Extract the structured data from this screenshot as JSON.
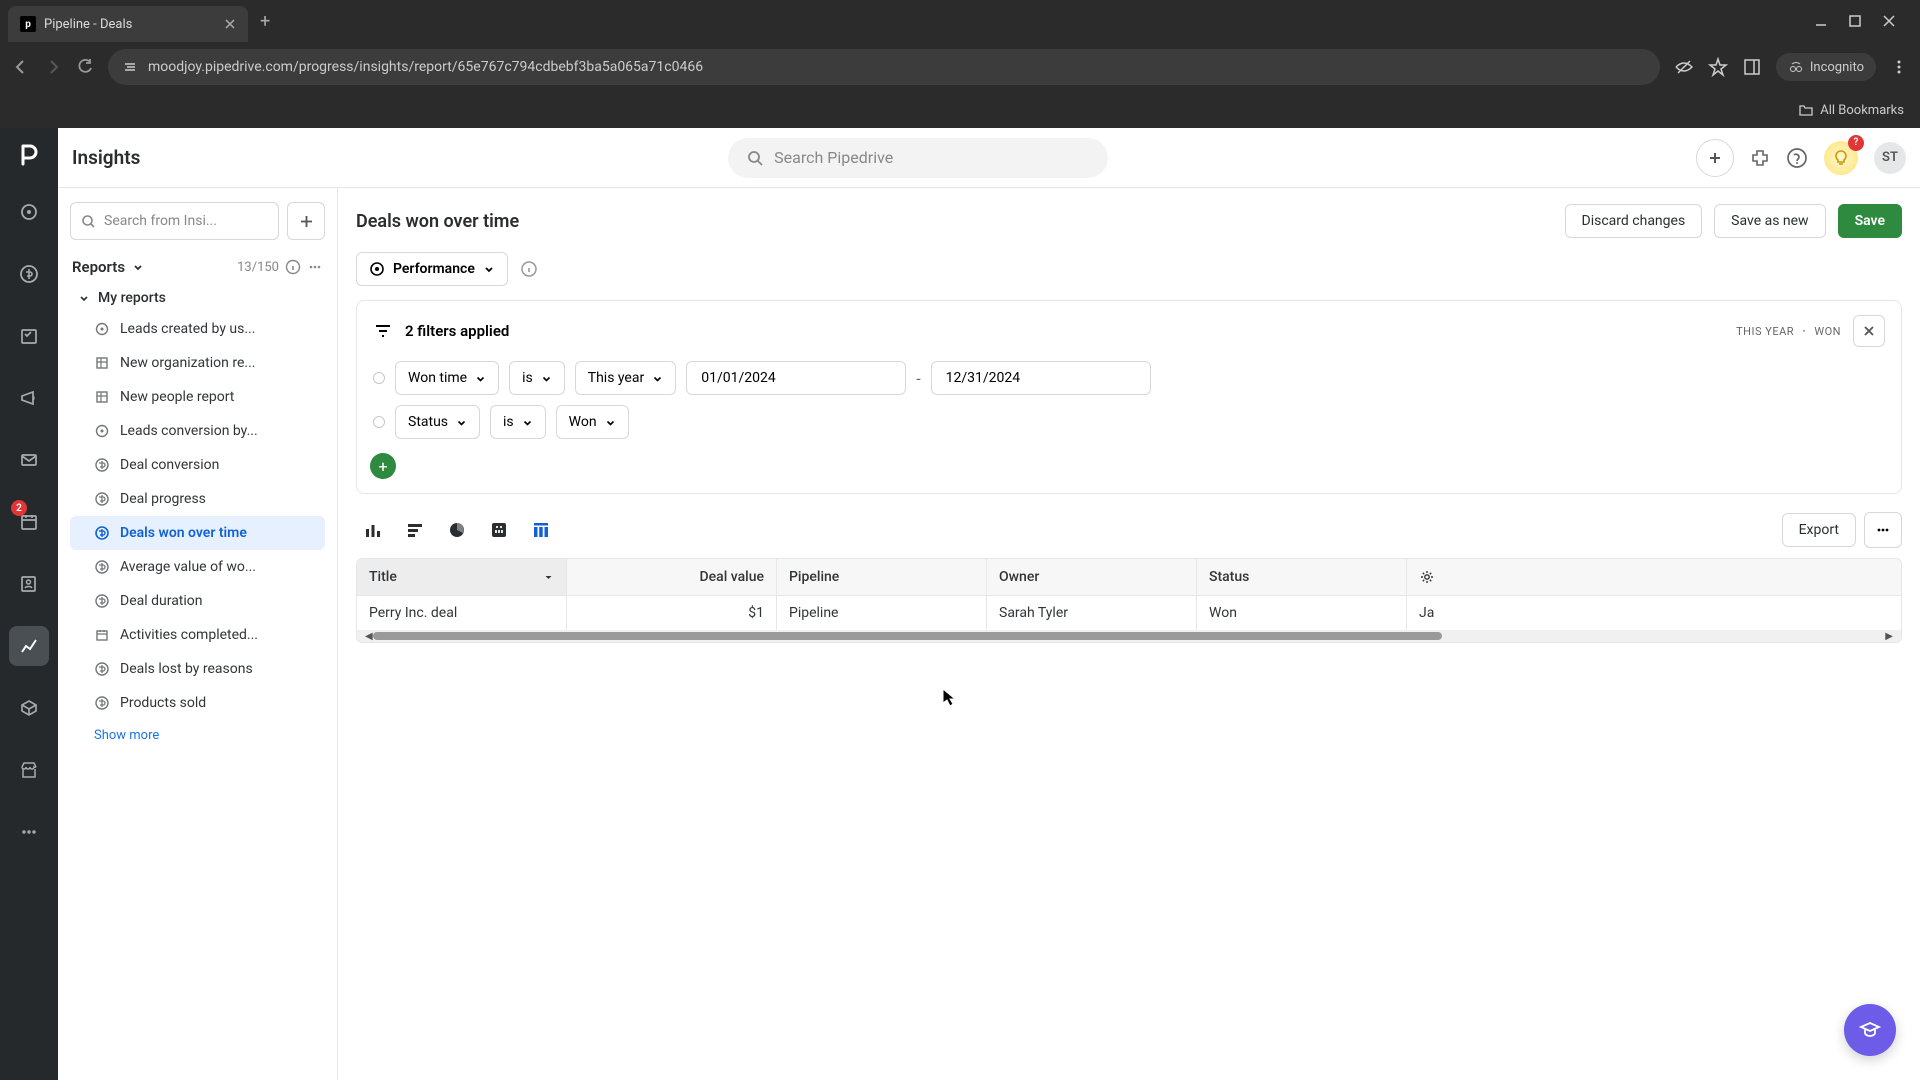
{
  "browser": {
    "tab_title": "Pipeline - Deals",
    "url": "moodjoy.pipedrive.com/progress/insights/report/65e767c794cdbebf3ba5a065a71c0466",
    "incognito_label": "Incognito",
    "bookmarks_label": "All Bookmarks"
  },
  "header": {
    "page_title": "Insights",
    "search_placeholder": "Search Pipedrive",
    "avatar_initials": "ST",
    "bulb_badge": "?"
  },
  "rail": {
    "badge_count": "2"
  },
  "sidebar": {
    "search_placeholder": "Search from Insi...",
    "reports_label": "Reports",
    "reports_count": "13/150",
    "group_label": "My reports",
    "items": [
      "Leads created by us...",
      "New organization re...",
      "New people report",
      "Leads conversion by...",
      "Deal conversion",
      "Deal progress",
      "Deals won over time",
      "Average value of wo...",
      "Deal duration",
      "Activities completed...",
      "Deals lost by reasons",
      "Products sold"
    ],
    "show_more": "Show more"
  },
  "report": {
    "title": "Deals won over time",
    "discard_btn": "Discard changes",
    "save_as_btn": "Save as new",
    "save_btn": "Save",
    "perf_label": "Performance"
  },
  "filters": {
    "summary": "2 filters applied",
    "tag1": "THIS YEAR",
    "tag2": "WON",
    "row1_field": "Won time",
    "row1_op": "is",
    "row1_val": "This year",
    "date_start": "01/01/2024",
    "date_end": "12/31/2024",
    "row2_field": "Status",
    "row2_op": "is",
    "row2_val": "Won"
  },
  "toolbar": {
    "export_label": "Export"
  },
  "table": {
    "cols": [
      "Title",
      "Deal value",
      "Pipeline",
      "Owner",
      "Status"
    ],
    "row": {
      "title": "Perry Inc. deal",
      "deal_value": "$1",
      "pipeline": "Pipeline",
      "owner": "Sarah Tyler",
      "status": "Won",
      "extra": "Ja"
    }
  }
}
